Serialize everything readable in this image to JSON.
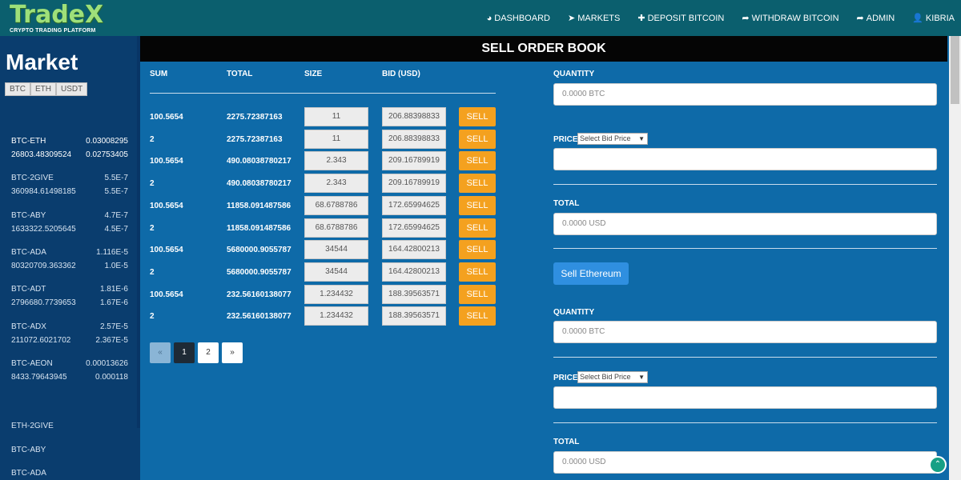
{
  "brand": {
    "name": "TradeX",
    "tagline": "CRYPTO TRADING PLATFORM"
  },
  "nav": [
    {
      "label": "DASHBOARD",
      "icon": "dashboard-icon",
      "glyph": "◕"
    },
    {
      "label": "MARKETS",
      "icon": "markets-send-icon",
      "glyph": "➤"
    },
    {
      "label": "DEPOSIT BITCOIN",
      "icon": "plus-icon",
      "glyph": "✚"
    },
    {
      "label": "WITHDRAW BITCOIN",
      "icon": "share-arrow-icon",
      "glyph": "➦"
    },
    {
      "label": "ADMIN",
      "icon": "share-arrow-icon",
      "glyph": "➦"
    },
    {
      "label": "KIBRIA",
      "icon": "user-icon",
      "glyph": "👤"
    }
  ],
  "sidebar": {
    "title": "Market",
    "tabs": [
      "BTC",
      "ETH",
      "USDT"
    ],
    "pairs": [
      {
        "name": "BTC-ETH",
        "price": "0.03008295",
        "volume": "26803.48309524",
        "change": "0.02753405",
        "active": true
      },
      {
        "name": "BTC-2GIVE",
        "price": "5.5E-7",
        "volume": "360984.61498185",
        "change": "5.5E-7"
      },
      {
        "name": "BTC-ABY",
        "price": "4.7E-7",
        "volume": "1633322.5205645",
        "change": "4.5E-7"
      },
      {
        "name": "BTC-ADA",
        "price": "1.116E-5",
        "volume": "80320709.363362",
        "change": "1.0E-5"
      },
      {
        "name": "BTC-ADT",
        "price": "1.81E-6",
        "volume": "2796680.7739653",
        "change": "1.67E-6"
      },
      {
        "name": "BTC-ADX",
        "price": "2.57E-5",
        "volume": "211072.6021702",
        "change": "2.367E-5"
      },
      {
        "name": "BTC-AEON",
        "price": "0.00013626",
        "volume": "8433.79643945",
        "change": "0.000118"
      }
    ],
    "other_pairs": [
      "ETH-2GIVE",
      "BTC-ABY",
      "BTC-ADA"
    ]
  },
  "order_book": {
    "title": "SELL ORDER BOOK",
    "columns": [
      "SUM",
      "TOTAL",
      "SIZE",
      "BID (USD)"
    ],
    "sell_label": "SELL",
    "rows": [
      {
        "sum": "100.5654",
        "total": "2275.72387163",
        "size": "11",
        "bid": "206.88398833"
      },
      {
        "sum": "2",
        "total": "2275.72387163",
        "size": "11",
        "bid": "206.88398833"
      },
      {
        "sum": "100.5654",
        "total": "490.08038780217",
        "size": "2.343",
        "bid": "209.16789919"
      },
      {
        "sum": "2",
        "total": "490.08038780217",
        "size": "2.343",
        "bid": "209.16789919"
      },
      {
        "sum": "100.5654",
        "total": "11858.091487586",
        "size": "68.6788786",
        "bid": "172.65994625"
      },
      {
        "sum": "2",
        "total": "11858.091487586",
        "size": "68.6788786",
        "bid": "172.65994625"
      },
      {
        "sum": "100.5654",
        "total": "5680000.9055787",
        "size": "34544",
        "bid": "164.42800213"
      },
      {
        "sum": "2",
        "total": "5680000.9055787",
        "size": "34544",
        "bid": "164.42800213"
      },
      {
        "sum": "100.5654",
        "total": "232.56160138077",
        "size": "1.234432",
        "bid": "188.39563571"
      },
      {
        "sum": "2",
        "total": "232.56160138077",
        "size": "1.234432",
        "bid": "188.39563571"
      }
    ],
    "pagination": {
      "prev": "«",
      "pages": [
        "1",
        "2"
      ],
      "next": "»",
      "current": "1"
    }
  },
  "form": {
    "quantity_label": "QUANTITY",
    "quantity_placeholder": "0.0000 BTC",
    "price_label": "PRICE",
    "price_select": "Select Bid Price",
    "price_value": "",
    "total_label": "TOTAL",
    "total_placeholder": "0.0000 USD",
    "sell_button": "Sell Ethereum"
  },
  "scroll_top_glyph": "⌃"
}
